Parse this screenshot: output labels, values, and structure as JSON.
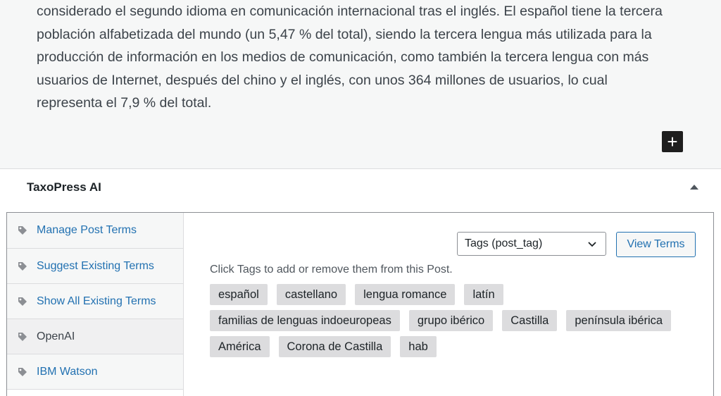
{
  "editor": {
    "paragraph_lines": [
      "considerado el segundo idioma en comunicación internacional tras el inglés. El español tiene la tercera",
      "población alfabetizada del mundo (un 5,47 % del total), siendo la tercera lengua más utilizada para la",
      "producción de información en los medios de comunicación, como también la tercera lengua con más",
      "usuarios de Internet, después del chino y el inglés, con unos 364 millones de usuarios, lo cual",
      "representa el 7,9 % del total."
    ],
    "inserter_symbol": "+"
  },
  "metabox": {
    "title": "TaxoPress AI"
  },
  "sidebar": {
    "items": [
      {
        "label": "Manage Post Terms",
        "icon": "tag-icon"
      },
      {
        "label": "Suggest Existing Terms",
        "icon": "tag-icon"
      },
      {
        "label": "Show All Existing Terms",
        "icon": "tag-icon"
      },
      {
        "label": "OpenAI",
        "icon": "tag-icon",
        "active": true
      },
      {
        "label": "IBM Watson",
        "icon": "tag-icon"
      }
    ]
  },
  "main": {
    "taxonomy_select": "Tags (post_tag)",
    "view_terms_label": "View Terms",
    "help_text": "Click Tags to add or remove them from this Post.",
    "tag_rows": [
      [
        "español",
        "castellano",
        "lengua romance",
        "latín"
      ],
      [
        "familias de lenguas indoeuropeas",
        "grupo ibérico",
        "Castilla",
        "península ibérica"
      ],
      [
        "América",
        "Corona de Castilla",
        "hab"
      ]
    ]
  },
  "colors": {
    "link": "#2271b1",
    "tag_bg": "#dcdcde",
    "editor_bg": "#f6f7f7"
  }
}
